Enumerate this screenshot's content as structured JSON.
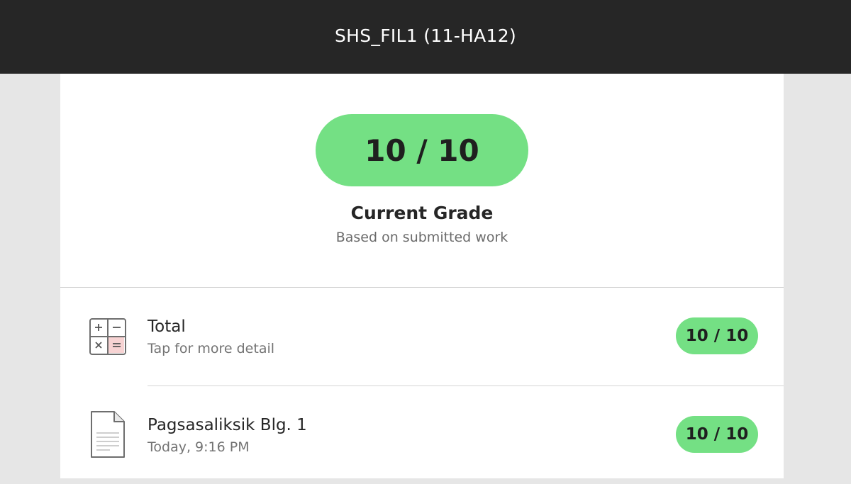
{
  "header": {
    "title": "SHS_FIL1 (11-HA12)"
  },
  "grade": {
    "value": "10 / 10",
    "title": "Current Grade",
    "subtitle": "Based on submitted work"
  },
  "rows": [
    {
      "icon": "calculator-icon",
      "title": "Total",
      "subtitle": "Tap for more detail",
      "score": "10 / 10"
    },
    {
      "icon": "document-icon",
      "title": "Pagsasaliksik Blg. 1",
      "subtitle": "Today, 9:16 PM",
      "score": "10 / 10"
    }
  ],
  "colors": {
    "topbar": "#262626",
    "grade_pill": "#74e084",
    "background": "#e6e6e6",
    "card": "#ffffff"
  }
}
